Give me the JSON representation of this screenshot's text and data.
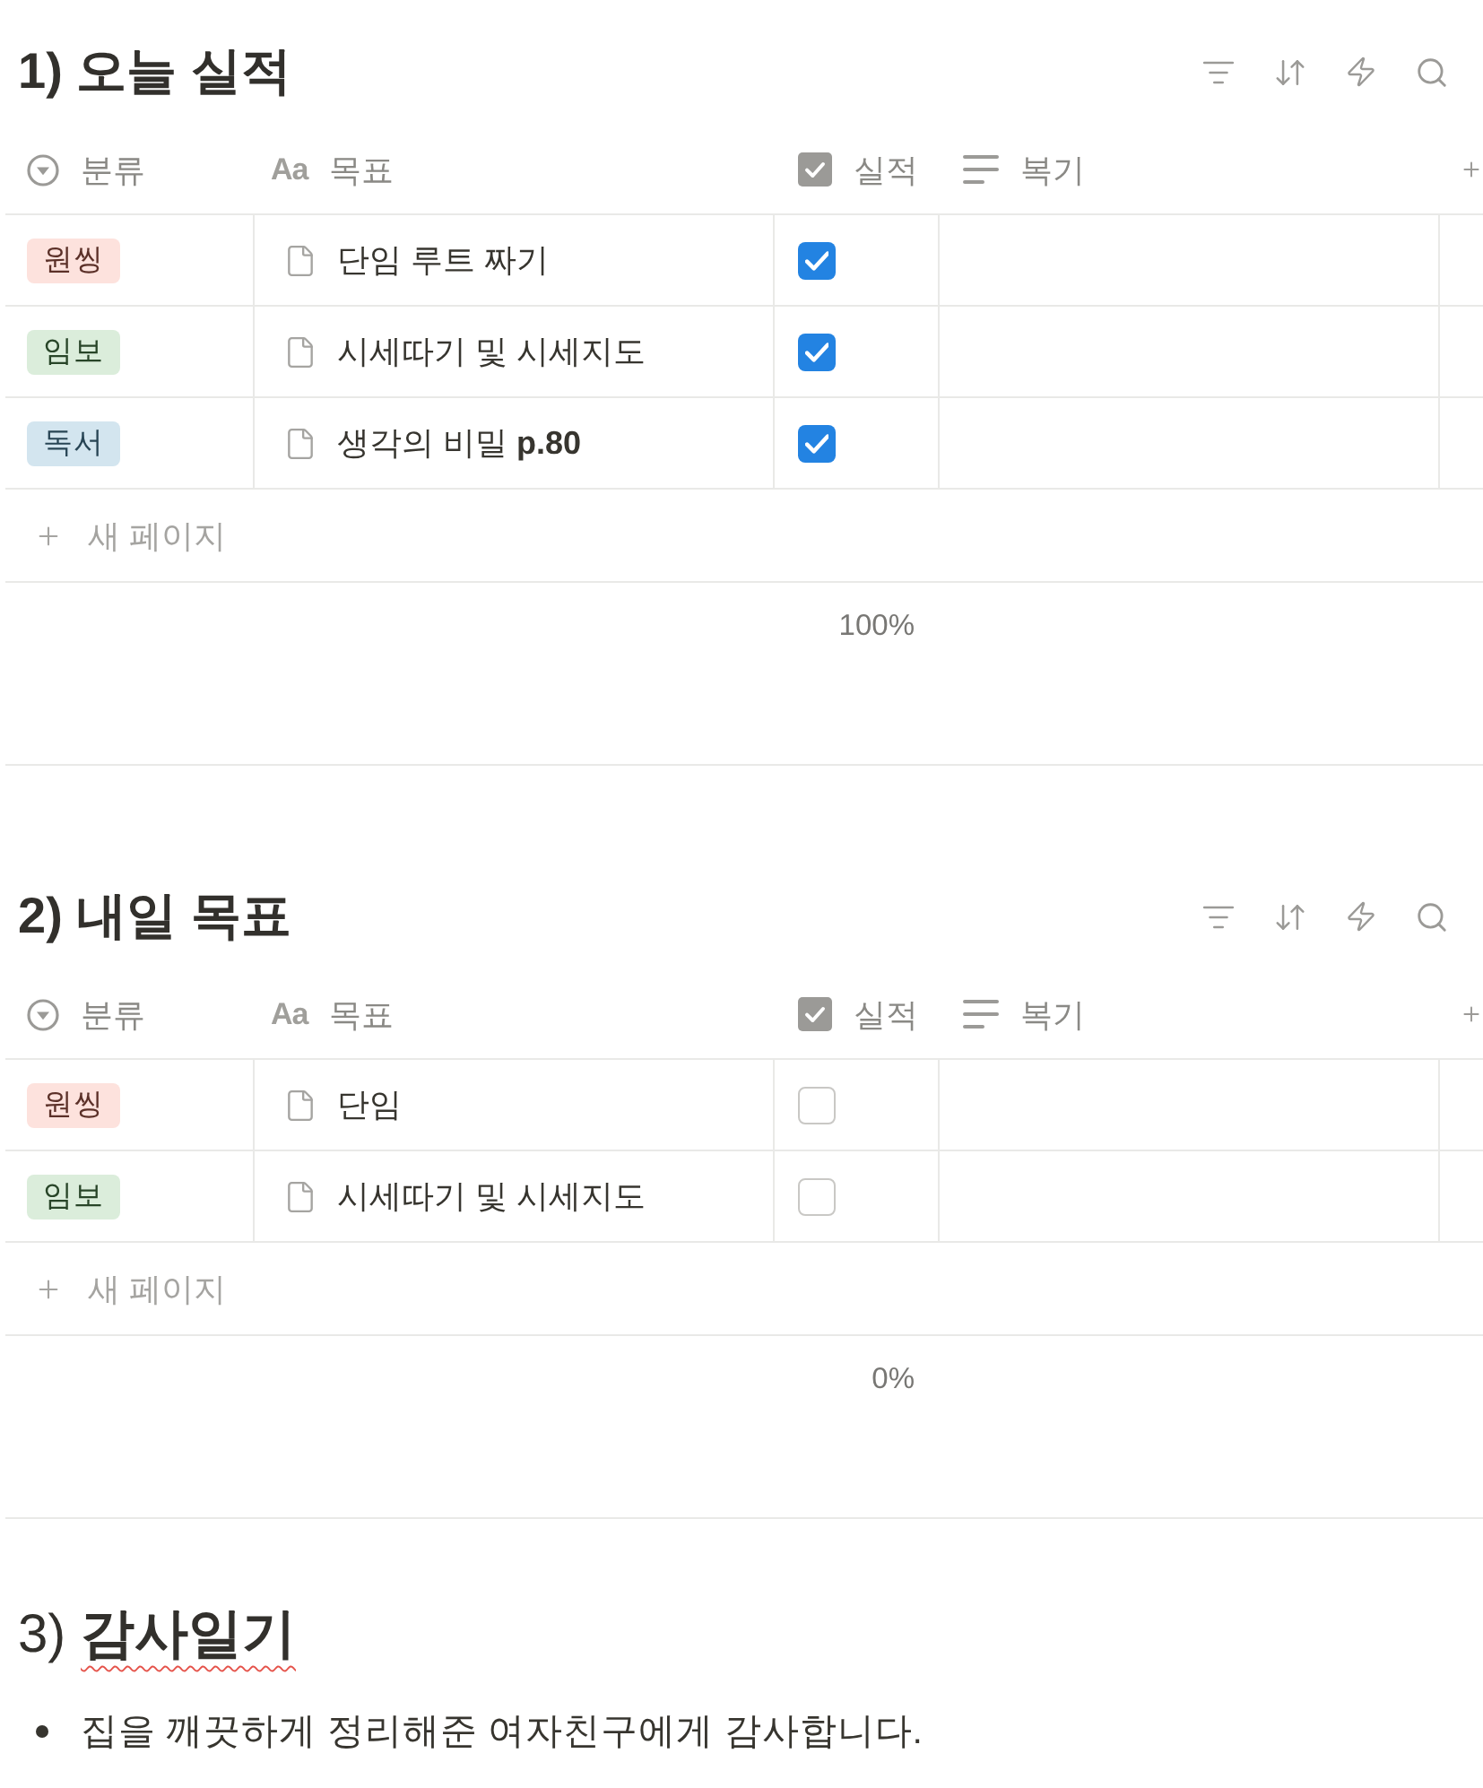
{
  "sections": [
    {
      "kind": "database",
      "title": "1) 오늘 실적",
      "columns": [
        {
          "kind": "select",
          "label": "분류"
        },
        {
          "kind": "title",
          "glyph": "Aa",
          "label": "목표"
        },
        {
          "kind": "checkbox",
          "label": "실적"
        },
        {
          "kind": "text",
          "label": "복기"
        }
      ],
      "rows": [
        {
          "category": {
            "label": "원씽",
            "color": "#fde2dd"
          },
          "goal": "단임 루트 짜기",
          "done": true
        },
        {
          "category": {
            "label": "임보",
            "color": "#dbeddb"
          },
          "goal": "시세따기 및 시세지도",
          "done": true
        },
        {
          "category": {
            "label": "독서",
            "color": "#d3e5ef"
          },
          "goal": "생각의 비밀 **p.80**",
          "done": true
        }
      ],
      "new_row_label": "새 페이지",
      "summary": "100%"
    },
    {
      "kind": "database",
      "title": "2) 내일 목표",
      "columns": [
        {
          "kind": "select",
          "label": "분류"
        },
        {
          "kind": "title",
          "glyph": "Aa",
          "label": "목표"
        },
        {
          "kind": "checkbox",
          "label": "실적"
        },
        {
          "kind": "text",
          "label": "복기"
        }
      ],
      "rows": [
        {
          "category": {
            "label": "원씽",
            "color": "#fde2dd"
          },
          "goal": "단임",
          "done": false
        },
        {
          "category": {
            "label": "임보",
            "color": "#dbeddb"
          },
          "goal": "시세따기 및 시세지도",
          "done": false
        }
      ],
      "new_row_label": "새 페이지",
      "summary": "0%"
    },
    {
      "kind": "text",
      "heading": "3) **감사일기**",
      "bullets": [
        "집을 깨끗하게 정리해준 여자친구에게 감사합니다."
      ]
    }
  ]
}
